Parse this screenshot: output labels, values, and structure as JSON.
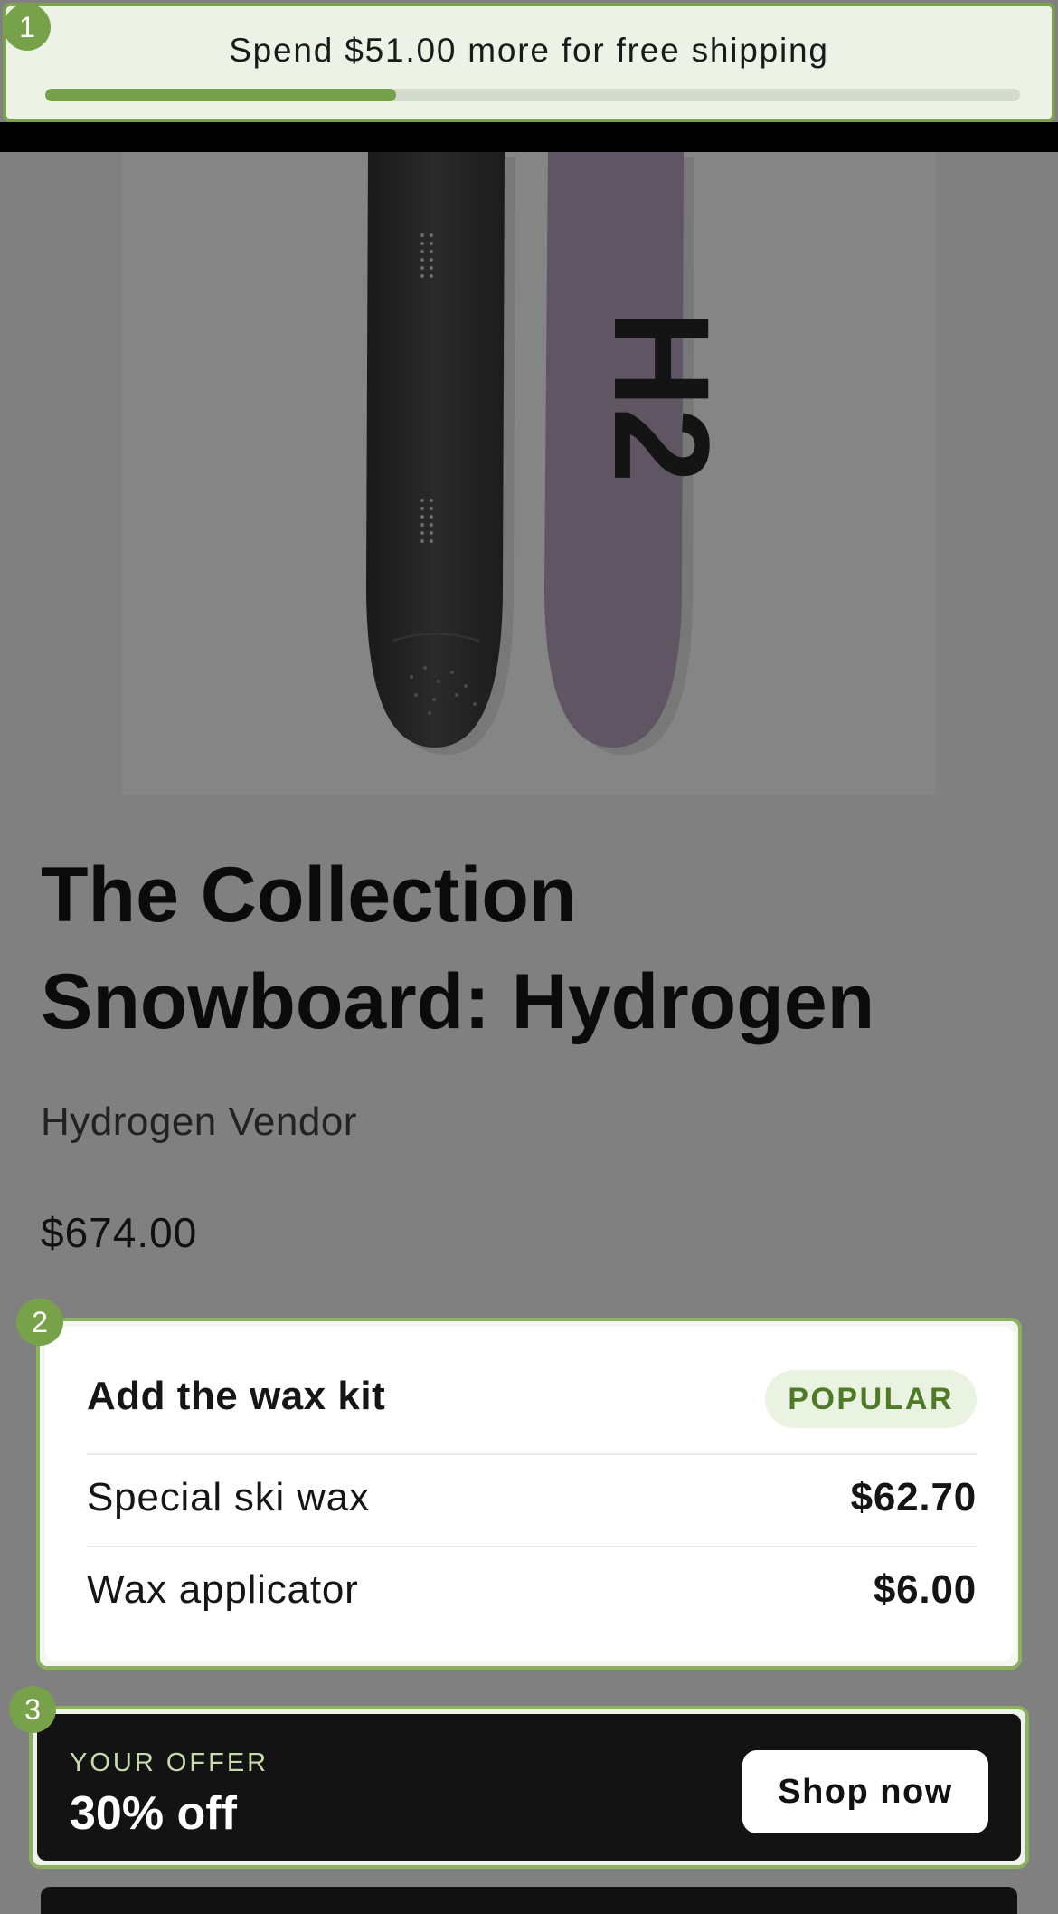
{
  "shipping_banner": {
    "message": "Spend $51.00 more for free shipping",
    "progress_fraction": 0.36,
    "badge": "1"
  },
  "product": {
    "title": "The Collection Snowboard: Hydrogen",
    "vendor": "Hydrogen Vendor",
    "price": "$674.00",
    "image_icon": "snowboard-image",
    "board_graphic_text": "H2"
  },
  "wax_kit": {
    "badge": "2",
    "title": "Add the wax kit",
    "pill": "POPULAR",
    "items": [
      {
        "name": "Special ski wax",
        "price": "$62.70"
      },
      {
        "name": "Wax applicator",
        "price": "$6.00"
      }
    ]
  },
  "offer": {
    "badge": "3",
    "kicker": "YOUR OFFER",
    "headline": "30% off",
    "button_label": "Shop now"
  },
  "colors": {
    "accent_green": "#7aa24c",
    "overlay_gray": "#808080",
    "offer_bg": "#131313"
  }
}
